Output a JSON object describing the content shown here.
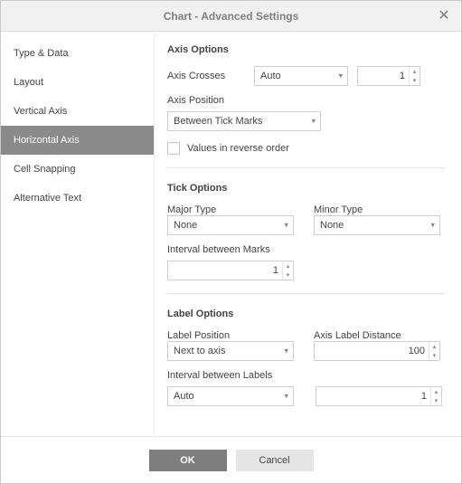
{
  "dialog": {
    "title": "Chart - Advanced Settings",
    "close": "✕"
  },
  "sidebar": {
    "items": [
      {
        "label": "Type & Data"
      },
      {
        "label": "Layout"
      },
      {
        "label": "Vertical Axis"
      },
      {
        "label": "Horizontal Axis"
      },
      {
        "label": "Cell Snapping"
      },
      {
        "label": "Alternative Text"
      }
    ],
    "active_index": 3
  },
  "axis_options": {
    "title": "Axis Options",
    "axis_crosses_label": "Axis Crosses",
    "axis_crosses_value": "Auto",
    "axis_crosses_number": "1",
    "axis_position_label": "Axis Position",
    "axis_position_value": "Between Tick Marks",
    "reverse_label": "Values in reverse order",
    "reverse_checked": false
  },
  "tick_options": {
    "title": "Tick Options",
    "major_label": "Major Type",
    "major_value": "None",
    "minor_label": "Minor Type",
    "minor_value": "None",
    "interval_label": "Interval between Marks",
    "interval_value": "1"
  },
  "label_options": {
    "title": "Label Options",
    "position_label": "Label Position",
    "position_value": "Next to axis",
    "distance_label": "Axis Label Distance",
    "distance_value": "100",
    "interval_label": "Interval between Labels",
    "interval_select": "Auto",
    "interval_value": "1"
  },
  "buttons": {
    "ok": "OK",
    "cancel": "Cancel"
  }
}
